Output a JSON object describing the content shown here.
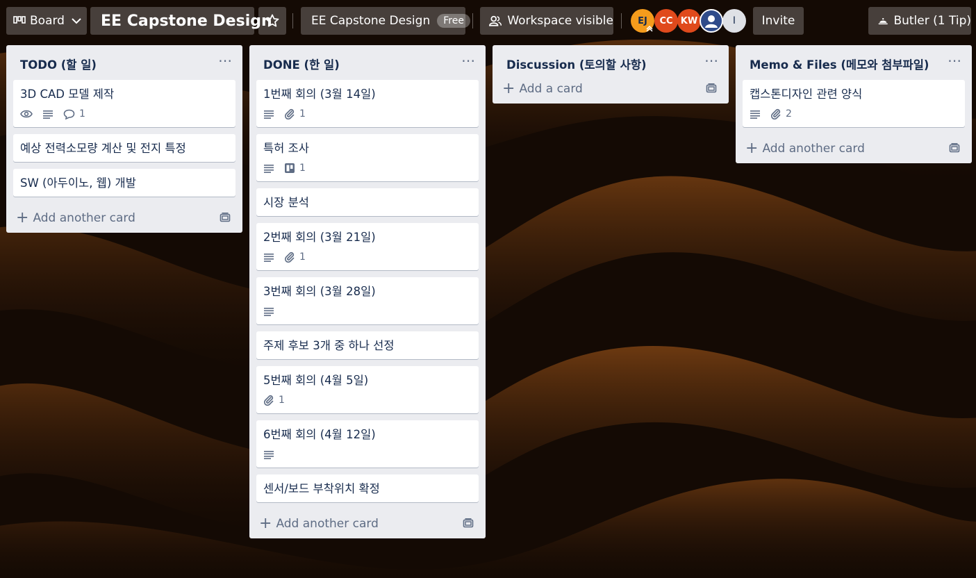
{
  "topbar": {
    "board_switcher": "Board",
    "board_title": "EE Capstone Design",
    "workspace_name": "EE Capstone Design",
    "plan_badge": "Free",
    "visibility": "Workspace visible",
    "invite": "Invite",
    "butler": "Butler (1 Tip)",
    "members": [
      {
        "initials": "EJ",
        "color": "#f59c1c"
      },
      {
        "initials": "CC",
        "color": "#e04a1c"
      },
      {
        "initials": "KW",
        "color": "#e04a1c"
      },
      {
        "initials": "",
        "color": "#2f4b8a",
        "icon": "user-icon"
      },
      {
        "initials": "I",
        "color": "#dfe1e6"
      }
    ]
  },
  "lists": [
    {
      "title": "TODO (할 일)",
      "add_label": "Add another card",
      "cards": [
        {
          "title": "3D CAD 모델 제작",
          "badges": [
            {
              "icon": "eye-icon"
            },
            {
              "icon": "description-icon"
            },
            {
              "icon": "comment-icon",
              "count": "1"
            }
          ]
        },
        {
          "title": "예상 전력소모량 계산 및 전지 특정",
          "badges": []
        },
        {
          "title": "SW (아두이노, 웹) 개발",
          "badges": []
        }
      ]
    },
    {
      "title": "DONE (한 일)",
      "add_label": "Add another card",
      "cards": [
        {
          "title": "1번째 회의 (3월 14일)",
          "badges": [
            {
              "icon": "description-icon"
            },
            {
              "icon": "attachment-icon",
              "count": "1"
            }
          ]
        },
        {
          "title": "특허 조사",
          "badges": [
            {
              "icon": "description-icon"
            },
            {
              "icon": "trello-card-icon",
              "count": "1"
            }
          ]
        },
        {
          "title": "시장 분석",
          "badges": []
        },
        {
          "title": "2번째 회의 (3월 21일)",
          "badges": [
            {
              "icon": "description-icon"
            },
            {
              "icon": "attachment-icon",
              "count": "1"
            }
          ]
        },
        {
          "title": "3번째 회의 (3월 28일)",
          "badges": [
            {
              "icon": "description-icon"
            }
          ]
        },
        {
          "title": "주제 후보 3개 중 하나 선정",
          "badges": []
        },
        {
          "title": "5번째 회의 (4월 5일)",
          "badges": [
            {
              "icon": "attachment-icon",
              "count": "1"
            }
          ]
        },
        {
          "title": "6번째 회의 (4월 12일)",
          "badges": [
            {
              "icon": "description-icon"
            }
          ]
        },
        {
          "title": "센서/보드 부착위치 확정",
          "badges": []
        }
      ]
    },
    {
      "title": "Discussion (토의할 사항)",
      "add_label": "Add a card",
      "cards": []
    },
    {
      "title": "Memo & Files (메모와 첨부파일)",
      "add_label": "Add another card",
      "cards": [
        {
          "title": "캡스톤디자인 관련 양식",
          "badges": [
            {
              "icon": "description-icon"
            },
            {
              "icon": "attachment-icon",
              "count": "2"
            }
          ]
        }
      ]
    }
  ]
}
